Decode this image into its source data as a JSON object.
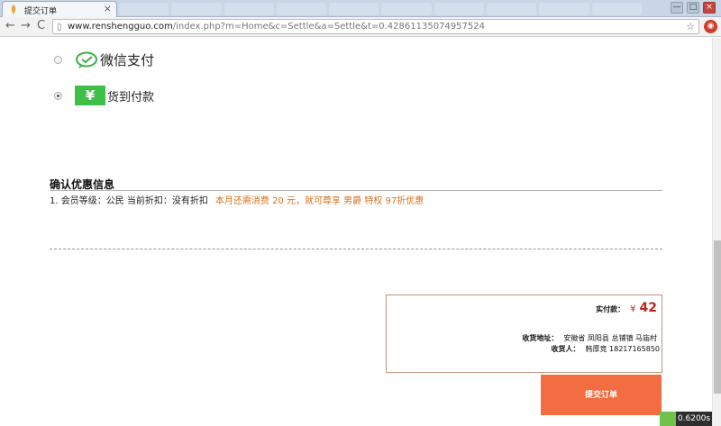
{
  "browser": {
    "tab_title": "提交订单",
    "tab_close": "×",
    "url_host": "www.renshengguo.com",
    "url_path": "/index.php?m=Home&c=Settle&a=Settle&t=0.42861135074957524",
    "back": "←",
    "forward": "→",
    "reload": "C",
    "star": "☆",
    "page_icon": "▯",
    "window_controls": [
      "—",
      "□",
      "×"
    ]
  },
  "payment": {
    "options": [
      {
        "label": "微信支付",
        "selected": false,
        "icon": "wechat-icon"
      },
      {
        "label": "货到付款",
        "icon_text": "¥",
        "selected": true,
        "icon": "yen-icon"
      }
    ]
  },
  "promo": {
    "title": "确认优惠信息",
    "item_text": "1. 会员等级：公民 当前折扣：没有折扣",
    "highlight": "本月还需消费 20 元，就可尊享 男爵 特权 97折优惠"
  },
  "summary": {
    "paid_label": "实付款：",
    "currency": "¥",
    "amount": "42",
    "address_label": "收货地址：",
    "address": "安徽省 凤阳县 总铺镇 马庙村",
    "receiver_label": "收货人：",
    "receiver": "韩厚竞 18217165850"
  },
  "submit_label": "提交订单",
  "timer": "0.6200s",
  "colors": {
    "accent": "#f36d42",
    "price": "#c0241b",
    "promo_highlight": "#d8711c",
    "cod_green": "#3fbf4a"
  }
}
